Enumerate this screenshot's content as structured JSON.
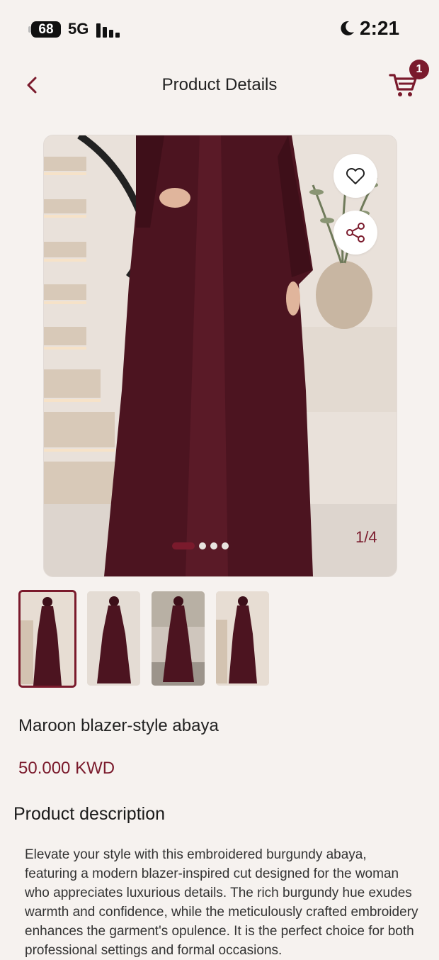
{
  "status_bar": {
    "battery": "68",
    "network": "5G",
    "time": "2:21",
    "icons": [
      "signal-icon",
      "moon-icon"
    ]
  },
  "header": {
    "title": "Product Details",
    "back_icon": "chevron-left-icon",
    "cart_icon": "cart-icon",
    "cart_count": "1"
  },
  "gallery": {
    "counter": "1/4",
    "current_index": 1,
    "total": 4,
    "actions": [
      "heart-icon",
      "share-icon"
    ],
    "thumbnail_count": 4,
    "selected_thumbnail": 1
  },
  "product": {
    "name": "Maroon blazer-style abaya",
    "price": "50.000 KWD"
  },
  "description": {
    "title": "Product description",
    "text": "Elevate your style with this embroidered burgundy abaya, featuring a modern blazer-inspired cut designed for the woman who appreciates luxurious details. The rich burgundy hue exudes warmth and confidence, while the meticulously crafted embroidery enhances the garment's opulence. It is the perfect choice for both professional settings and formal occasions."
  },
  "colors": {
    "accent": "#7a1a2c",
    "background": "#f6f2ef"
  }
}
